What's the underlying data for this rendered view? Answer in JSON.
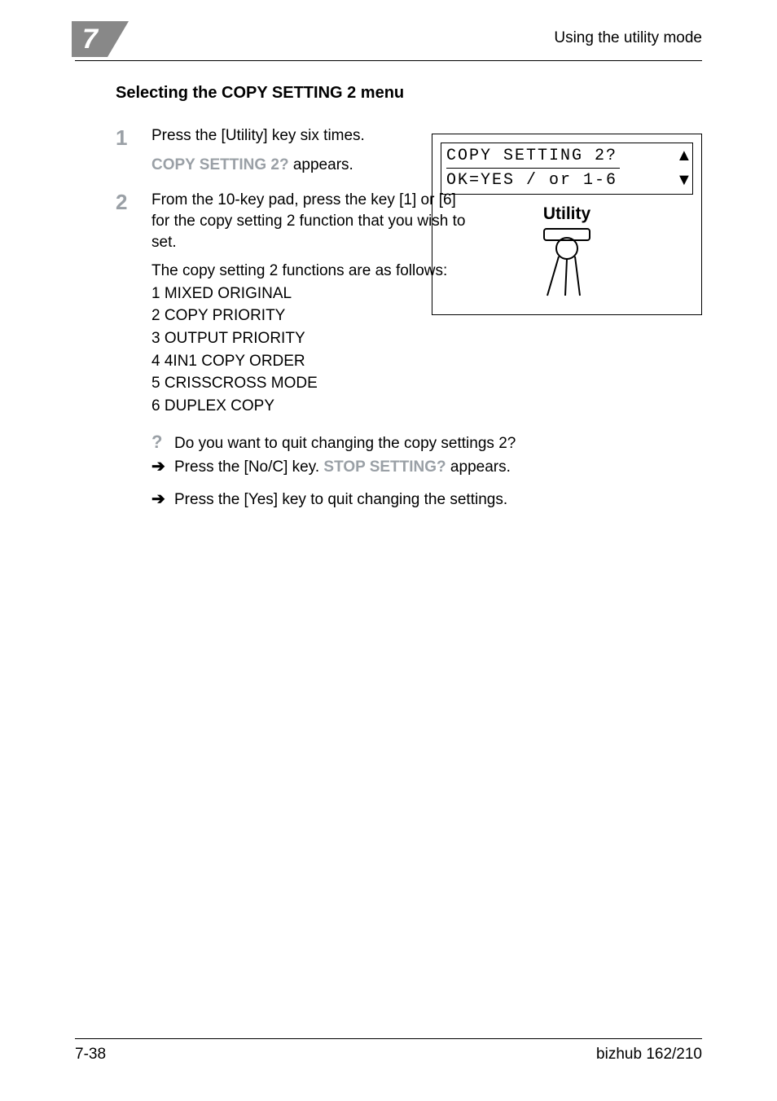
{
  "header": {
    "chapter_number": "7",
    "running_head": "Using the utility mode"
  },
  "section_title": "Selecting the COPY SETTING 2 menu",
  "steps": [
    {
      "num": "1",
      "line1": "Press the [Utility] key six times.",
      "sub_prefix": "COPY SETTING 2?",
      "sub_suffix": " appears."
    },
    {
      "num": "2",
      "line1": "From the 10-key pad, press the key [1] or [6] for the copy setting 2 function that you wish to set.",
      "sub_intro": "The copy setting 2 functions are as follows:",
      "options": [
        "1 MIXED ORIGINAL",
        "2 COPY PRIORITY",
        "3 OUTPUT PRIORITY",
        "4 4IN1 COPY ORDER",
        "5 CRISSCROSS MODE",
        "6 DUPLEX COPY"
      ]
    }
  ],
  "qa": {
    "question": "Do you want to quit changing the copy settings 2?",
    "answer1_prefix": "Press the [No/C] key. ",
    "answer1_gray": "STOP SETTING?",
    "answer1_suffix": " appears.",
    "answer2": "Press the [Yes] key to quit changing the settings."
  },
  "panel": {
    "lcd_line1": "COPY SETTING 2?",
    "lcd_line2": "OK=YES / or 1-6",
    "up_glyph": "▲",
    "down_glyph": "▼",
    "utility_label": "Utility"
  },
  "footer": {
    "page": "7-38",
    "product": "bizhub 162/210"
  }
}
